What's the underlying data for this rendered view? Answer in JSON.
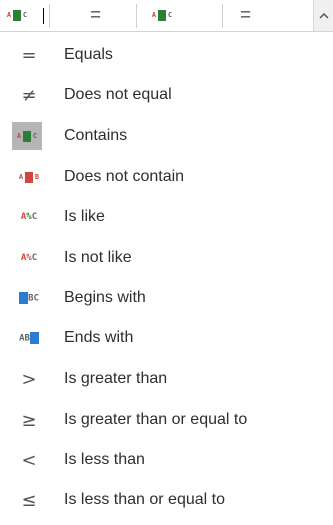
{
  "toolbar": {
    "filters": [
      {
        "icon": "contains-icon"
      },
      {
        "icon": "equals-icon",
        "symbol": "="
      },
      {
        "icon": "contains-icon"
      },
      {
        "icon": "equals-icon",
        "symbol": "="
      }
    ],
    "scroll_symbol": "^"
  },
  "menu": {
    "items": [
      {
        "label": "Equals",
        "icon": "equals-icon",
        "symbol": "="
      },
      {
        "label": "Does not equal",
        "icon": "not-equal-icon",
        "symbol": "≠"
      },
      {
        "label": "Contains",
        "icon": "contains-icon",
        "selected": true
      },
      {
        "label": "Does not contain",
        "icon": "does-not-contain-icon"
      },
      {
        "label": "Is like",
        "icon": "is-like-icon",
        "text": "A%C"
      },
      {
        "label": "Is not like",
        "icon": "is-not-like-icon",
        "text": "A%C"
      },
      {
        "label": "Begins with",
        "icon": "begins-with-icon",
        "text": "ABC"
      },
      {
        "label": "Ends with",
        "icon": "ends-with-icon",
        "text": "ABC"
      },
      {
        "label": "Is greater than",
        "icon": "greater-than-icon",
        "symbol": ">"
      },
      {
        "label": "Is greater than or equal to",
        "icon": "greater-or-equal-icon",
        "symbol": "≥"
      },
      {
        "label": "Is less than",
        "icon": "less-than-icon",
        "symbol": "<"
      },
      {
        "label": "Is less than or equal to",
        "icon": "less-or-equal-icon",
        "symbol": "≤"
      }
    ]
  },
  "colors": {
    "red": "#d0473f",
    "green": "#2c7f3a",
    "blue": "#2b7bd3",
    "selected_bg": "#b5b5b5"
  }
}
